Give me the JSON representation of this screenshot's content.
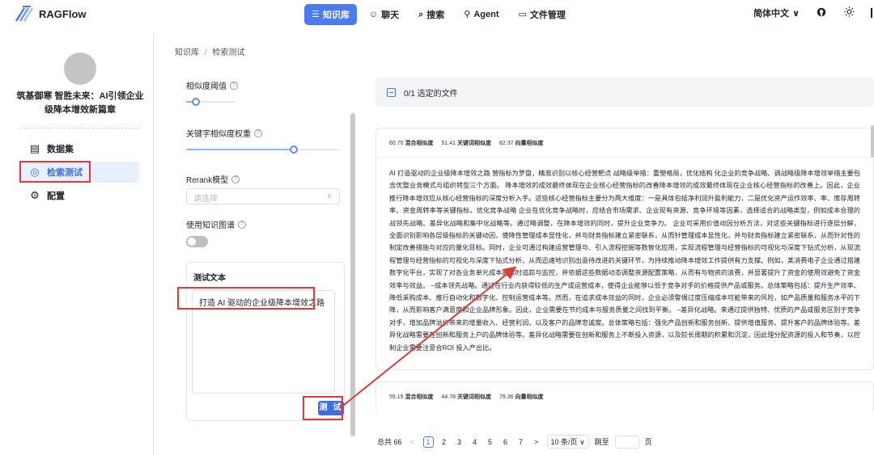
{
  "header": {
    "app_name": "RAGFlow",
    "nav": [
      {
        "label": "知识库",
        "icon": "☰",
        "active": true
      },
      {
        "label": "聊天",
        "icon": "☺"
      },
      {
        "label": "搜索",
        "icon": "⌕"
      },
      {
        "label": "Agent",
        "icon": "⚲"
      },
      {
        "label": "文件管理",
        "icon": "▭"
      }
    ],
    "language": "简体中文",
    "lang_caret": "∨",
    "github_icon": "github-icon",
    "theme_icon": "sun-icon"
  },
  "sidebar": {
    "kb_title": "筑基御寒 智胜未来：AI引领企业级降本增效新篇章",
    "items": [
      {
        "label": "数据集",
        "icon": "▤"
      },
      {
        "label": "检索测试",
        "icon": "◎",
        "active": true
      },
      {
        "label": "配置",
        "icon": "⚙"
      }
    ]
  },
  "breadcrumb": {
    "root": "知识库",
    "sep": "/",
    "current": "检索测试"
  },
  "settings": {
    "similarity_threshold_label": "相似度阈值",
    "similarity_threshold": 0.2,
    "keyword_weight_label": "关键字相似度权重",
    "keyword_weight": 0.7,
    "rerank_label": "Rerank模型",
    "rerank_placeholder": "请选择",
    "kg_label": "使用知识图谱",
    "kg_enabled": false,
    "test_text_title": "测试文本",
    "test_text_value": "打造 AI 驱动的企业级降本增效之路",
    "test_button": "测 试"
  },
  "results": {
    "file_summary": "0/1  选定的文件",
    "cards": [
      {
        "hybrid_score": "60.70",
        "hybrid_label": "混合相似度",
        "keyword_score": "51.41",
        "keyword_label": "关键词相似度",
        "vector_score": "82.37",
        "vector_label": "向量相似度",
        "content": "AI 打造驱动的企业级降本增效之路 营指标为罗盘，精准识别以核心经营靶点 战略级举措：重塑格局，优化结构 化企业的竞争战略、调战略级降本增效举措主要包含优整业务模式与组织转型三个方面。 降本增效的成效最终体现在企业核心经营指标的改善降本增效的成效最终体现在企业核心经营指标的改善上。因此，企业推行降本增效应从核心经营指标的深度分析入手。这些核心经营指标主要分为两大维度：一是具体包括净利润升盈利能力，二是优化资产运作效率、率、库存周转率、资金周转率等关键指标。优化竞争战略 企业在优化竞争战略时，应结合市场需求、企业现有资源、竞争环境等因素，选择适合的战略类型，例如成本合理的战领先战略、差异化战略和集中化战略等。通过略调整，在降本增效的同时，提升企业竞争力。 企业可采用价值动因分析方法，对这些关键指标进行逐层分解，全面识别影响各层级指标的关键动因，使降性管理成本显性化，并与财务指标建立紧密联系，从而针管理成本显性化，并与财务指标建立紧密联系，从而针对性的制定改善措施与对应的量化目标。同时，企业可通过构建运营管理与、引入流程挖掘等数智化应用，实现流程管理与经营指标的可视化与深度下钻式分析，从现流程管理与经营指标的可视化与深度下钻式分析，从而迅速地识别出亟待改进的关键环节，为持续推动降本增效工作提供有力支撑。例如，某消费电子企业通过搭建数字化平台，实现了对各业务单元成本的实时追踪与监控，并依据这些数据动态调整资源配置策略，从而有与物资的浪费，并显著提升了资金的使用效避免了资金效率与效益。 –成本领先战略。通过在行业内获得较低的生产或运营成本，使得企业能够以低于竞争对手的价格提供产品或服务。总体策略包括：提升生产效率、降低采购成本、推行自动化和数字化、控制运营成本等。然而，在追求成本效益的同时，企业必须警惕过度压缩成本可能带来的风险，如产品质量和服务水平的下降，从而影响客户满意度和企业品牌形象。因此，企业需要在节约成本与服务质量之间找到平衡。 –差异化战略。来通过提供独特、优质的产品或服务区别于竞争对手，增加品牌溢价带来的增量收入、经营利润，以及客户的品牌忠诚度。总体策略包括：强化产品创新和服务创新、提供增值服务、提升客户的品牌体验等。差异化战略需要在创新和服务上户的品牌体验等。差异化战略需要在创新和服务上不断投入资源，以及较长周期的积累和沉淀，因此理分配资源的投入和节奏，以控制企业需要注意合ROI 投入产出比。"
      },
      {
        "hybrid_score": "55.15",
        "hybrid_label": "混合相似度",
        "keyword_score": "44.78",
        "keyword_label": "关键词相似度",
        "vector_score": "79.36",
        "vector_label": "向量相似度"
      }
    ]
  },
  "pagination": {
    "total": "总共 66",
    "prev": "<",
    "pages": [
      "1",
      "2",
      "3",
      "4",
      "5",
      "6",
      "7"
    ],
    "current": "1",
    "next": ">",
    "page_size": "10 条/页",
    "page_size_caret": "∨",
    "goto": "跳至",
    "page_unit": "页"
  },
  "colors": {
    "accent": "#4a7cf0",
    "annotation_red": "#e53935",
    "sidebar_active_bg": "#e8f0fe"
  }
}
